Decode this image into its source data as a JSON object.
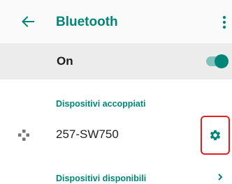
{
  "header": {
    "back_icon": "arrow-back-icon",
    "title": "Bluetooth",
    "menu_icon": "more-vert-icon"
  },
  "toggle": {
    "label": "On",
    "checked": true
  },
  "paired_section": {
    "header": "Dispositivi accoppiati",
    "devices": [
      {
        "icon": "gamepad-icon",
        "name": "257-SW750",
        "settings_icon": "gear-icon"
      }
    ]
  },
  "available_section": {
    "header": "Dispositivi disponibili"
  },
  "colors": {
    "accent": "#008577",
    "highlight_border": "#e01f22",
    "toggle_row_bg": "#ececec"
  }
}
